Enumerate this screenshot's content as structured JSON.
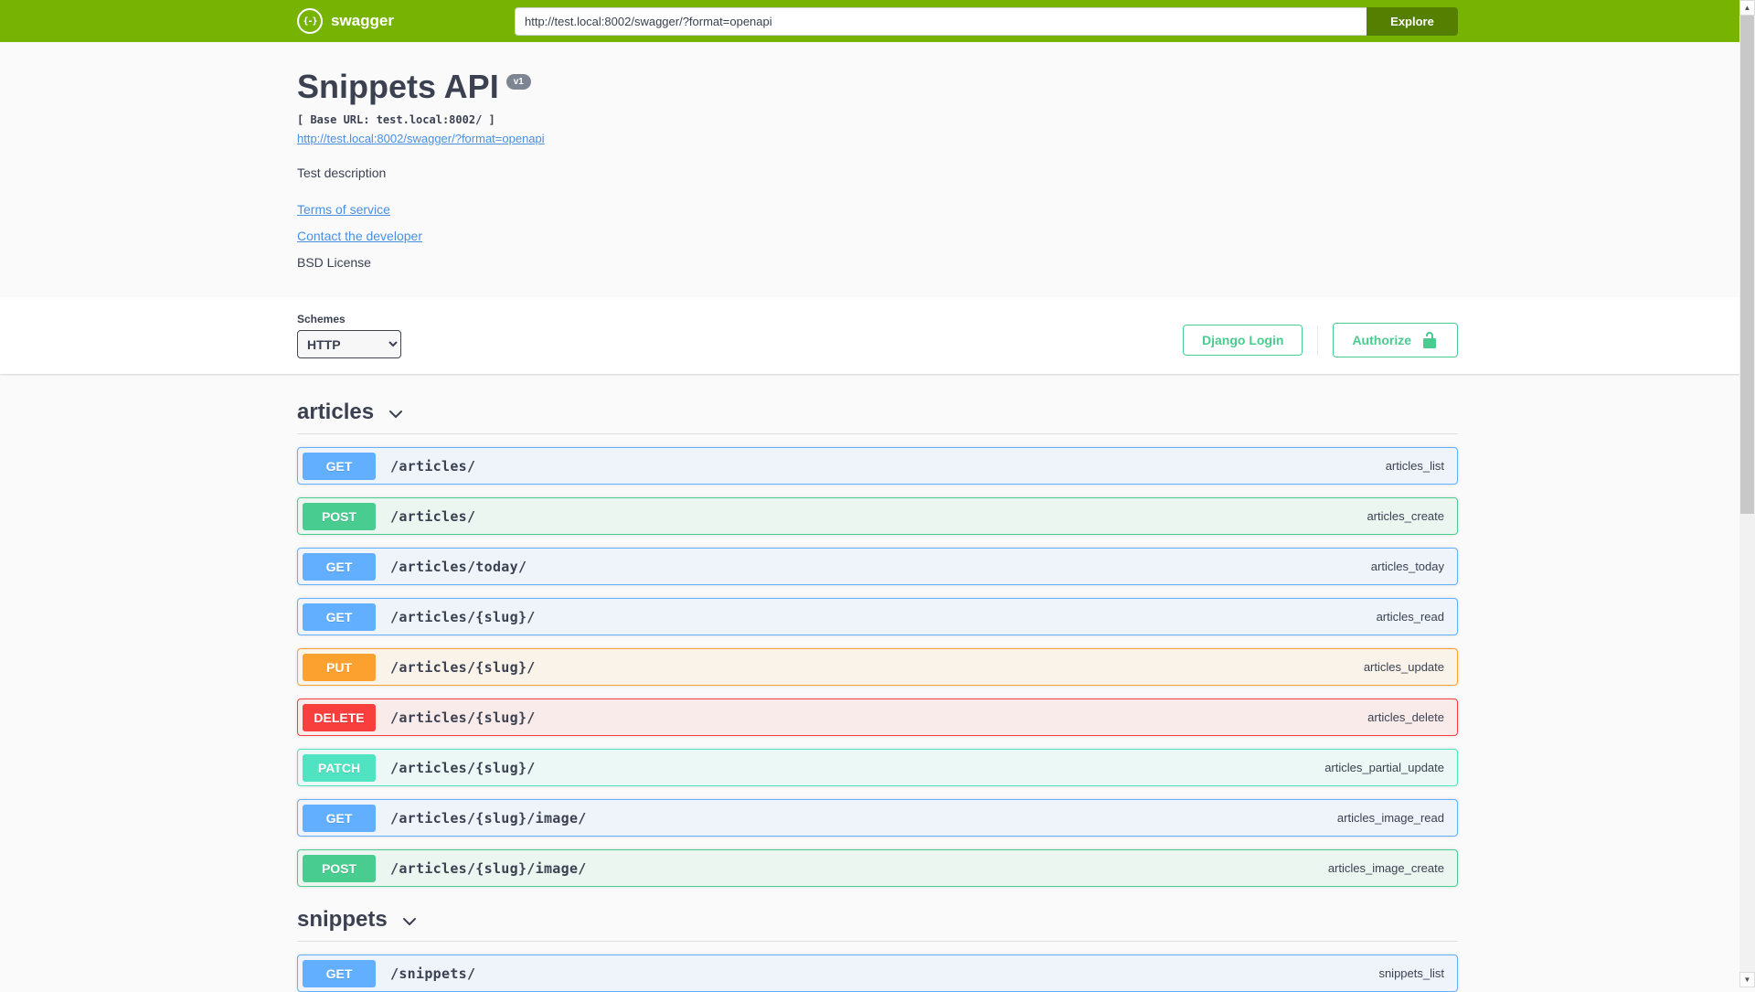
{
  "topbar": {
    "brand": "swagger",
    "logo_glyph": "{-}",
    "url_value": "http://test.local:8002/swagger/?format=openapi",
    "explore_label": "Explore"
  },
  "info": {
    "title": "Snippets API",
    "version_badge": "v1",
    "base_url": "[ Base URL: test.local:8002/ ]",
    "spec_link": "http://test.local:8002/swagger/?format=openapi",
    "description": "Test description",
    "terms_link": "Terms of service",
    "contact_link": "Contact the developer",
    "license": "BSD License"
  },
  "scheme": {
    "label": "Schemes",
    "selected": "HTTP",
    "django_login_label": "Django Login",
    "authorize_label": "Authorize"
  },
  "colors": {
    "get": "#61affe",
    "post": "#49cc90",
    "put": "#fca130",
    "delete": "#f93e3e",
    "patch": "#50e3c2",
    "topbar": "#76b303",
    "explore_button": "#547f00",
    "authorize_green": "#49cc90",
    "link_blue": "#4990e2",
    "text": "#3b4151"
  },
  "icons": {
    "scroll_up": "▲",
    "scroll_down": "▼"
  },
  "sections": [
    {
      "name": "articles",
      "operations": [
        {
          "method": "GET",
          "path": "/articles/",
          "operation_id": "articles_list"
        },
        {
          "method": "POST",
          "path": "/articles/",
          "operation_id": "articles_create"
        },
        {
          "method": "GET",
          "path": "/articles/today/",
          "operation_id": "articles_today"
        },
        {
          "method": "GET",
          "path": "/articles/{slug}/",
          "operation_id": "articles_read"
        },
        {
          "method": "PUT",
          "path": "/articles/{slug}/",
          "operation_id": "articles_update"
        },
        {
          "method": "DELETE",
          "path": "/articles/{slug}/",
          "operation_id": "articles_delete"
        },
        {
          "method": "PATCH",
          "path": "/articles/{slug}/",
          "operation_id": "articles_partial_update"
        },
        {
          "method": "GET",
          "path": "/articles/{slug}/image/",
          "operation_id": "articles_image_read"
        },
        {
          "method": "POST",
          "path": "/articles/{slug}/image/",
          "operation_id": "articles_image_create"
        }
      ]
    },
    {
      "name": "snippets",
      "operations": [
        {
          "method": "GET",
          "path": "/snippets/",
          "operation_id": "snippets_list"
        }
      ]
    }
  ]
}
